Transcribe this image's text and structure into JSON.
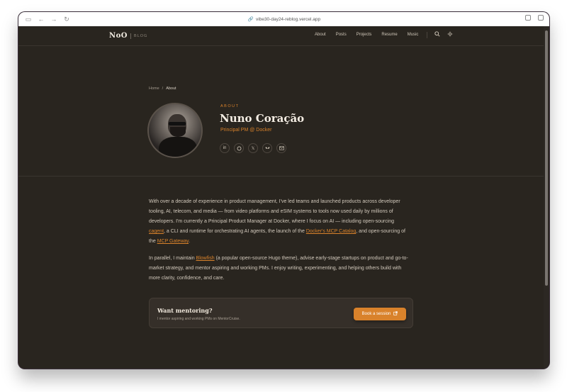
{
  "browser": {
    "url": "vibe30-day24-reblog.vercel.app",
    "icons": [
      "sidebar-icon",
      "back-icon",
      "forward-icon",
      "reload-icon",
      "link-icon",
      "extension-icon",
      "tabs-icon"
    ]
  },
  "nav": {
    "logo": "NoO",
    "logo_sub": "BLOG",
    "links": [
      "About",
      "Posts",
      "Projects",
      "Resume",
      "Music"
    ],
    "search_icon": "search-icon",
    "theme_icon": "sun-icon"
  },
  "breadcrumb": {
    "home": "Home",
    "sep": "/",
    "current": "About"
  },
  "profile": {
    "label": "ABOUT",
    "name": "Nuno Coração",
    "role": "Principal PM @ Docker",
    "socials": [
      "linkedin-icon",
      "github-icon",
      "x-icon",
      "bluesky-icon",
      "email-icon"
    ]
  },
  "prose": {
    "p1_a": "With over a decade of experience in product management, I've led teams and launched products across developer tooling, AI, telecom, and media — from video platforms and eSIM systems to tools now used daily by millions of developers. I'm currently a Principal Product Manager at Docker, where I focus on AI — including open-sourcing ",
    "p1_link1": "cagent",
    "p1_b": ", a CLI and runtime for orchestrating AI agents, the launch of the ",
    "p1_link2": "Docker's MCP Catalog",
    "p1_c": ", and open-sourcing of the ",
    "p1_link3": "MCP Gateway",
    "p1_d": ".",
    "p2_a": "In parallel, I maintain ",
    "p2_link1": "Blowfish",
    "p2_b": " (a popular open-source Hugo theme), advise early-stage startups on product and go-to-market strategy, and mentor aspiring and working PMs. I enjoy writing, experimenting, and helping others build with more clarity, confidence, and care."
  },
  "cta": {
    "title": "Want mentoring?",
    "subtitle": "I mentor aspiring and working PMs on MentorCruise.",
    "button": "Book a session",
    "button_icon": "external-link-icon"
  },
  "colors": {
    "accent": "#d9822b",
    "background": "#29251f",
    "text": "#d2c9bc"
  }
}
